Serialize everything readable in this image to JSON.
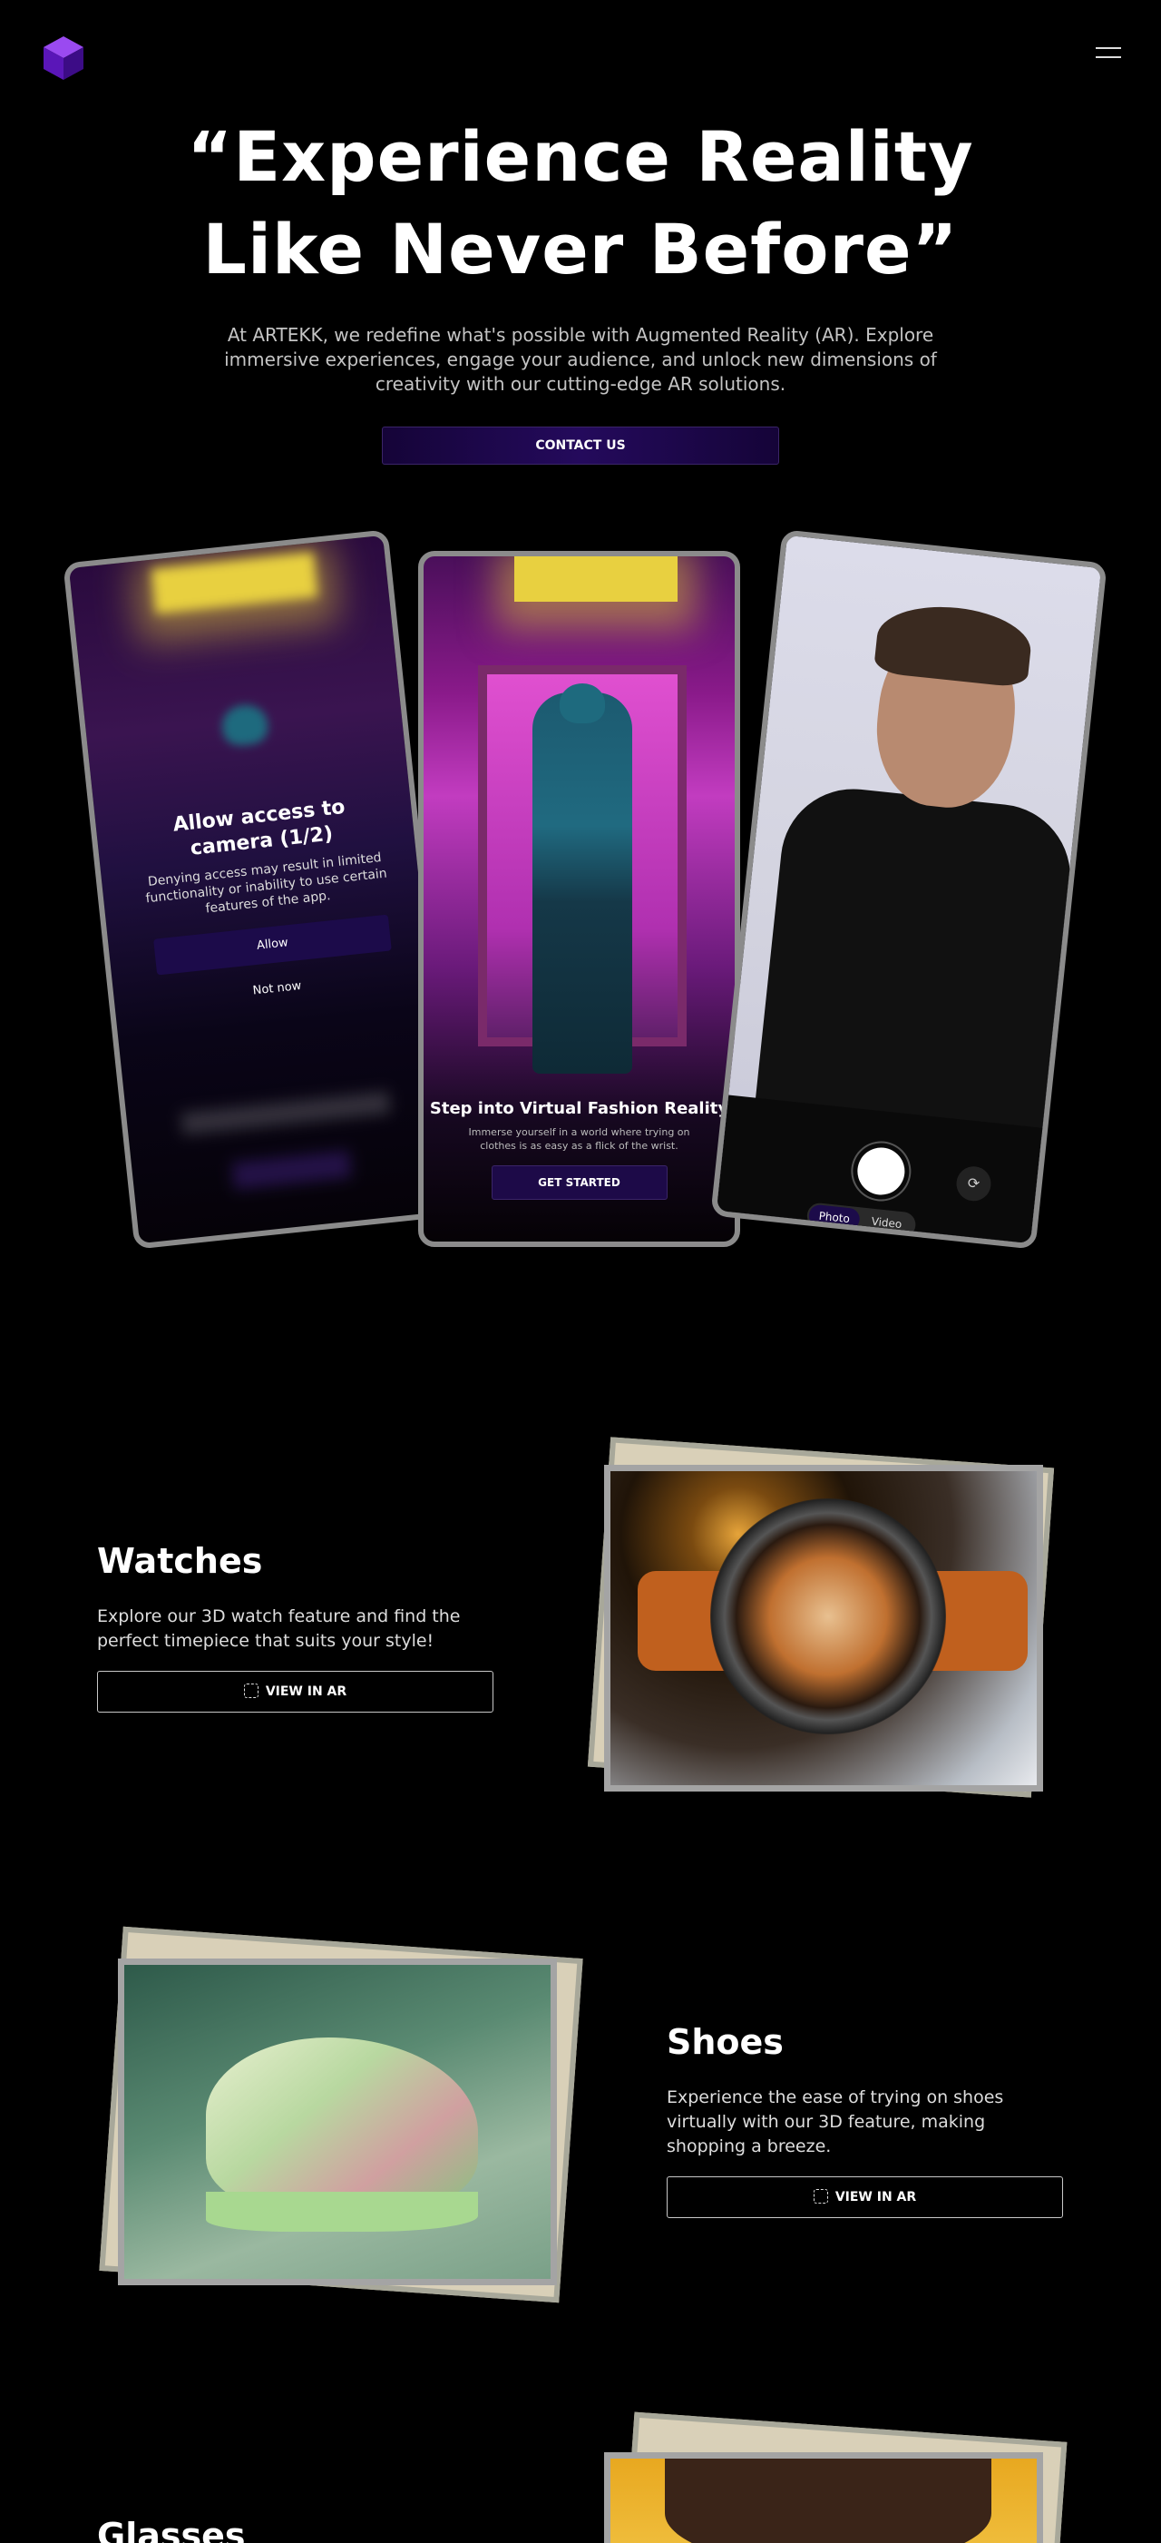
{
  "header": {
    "logo_icon": "cube-logo-icon",
    "menu_icon": "hamburger-menu-icon"
  },
  "hero": {
    "title": "“Experience Reality Like Never Before”",
    "subtitle": "At ARTEKK, we redefine what's possible with Augmented Reality (AR). Explore immersive experiences, engage your audience, and unlock new dimensions of creativity with our cutting-edge AR solutions.",
    "cta_label": "CONTACT US"
  },
  "phones": {
    "left": {
      "dialog_title": "Allow access to camera (1/2)",
      "dialog_text": "Denying access may result in limited functionality or inability to use certain features of the app.",
      "allow_label": "Allow",
      "deny_label": "Not now"
    },
    "middle": {
      "title": "Step into Virtual Fashion Reality",
      "text": "Immerse yourself in a world where trying on clothes is as easy as a flick of the wrist.",
      "cta_label": "GET STARTED"
    },
    "right": {
      "mode_photo": "Photo",
      "mode_video": "Video",
      "switch_camera_icon": "camera-switch-icon"
    }
  },
  "products": [
    {
      "title": "Watches",
      "description": "Explore our 3D watch feature and find the perfect timepiece that suits your style!",
      "button_label": "VIEW IN AR"
    },
    {
      "title": "Shoes",
      "description": "Experience the ease of trying on shoes virtually with our 3D feature, making shopping a breeze.",
      "button_label": "VIEW IN AR"
    },
    {
      "title": "Glasses"
    }
  ],
  "colors": {
    "background": "#000000",
    "accent": "#1c0b4a",
    "logo": "#6a1fd0"
  }
}
